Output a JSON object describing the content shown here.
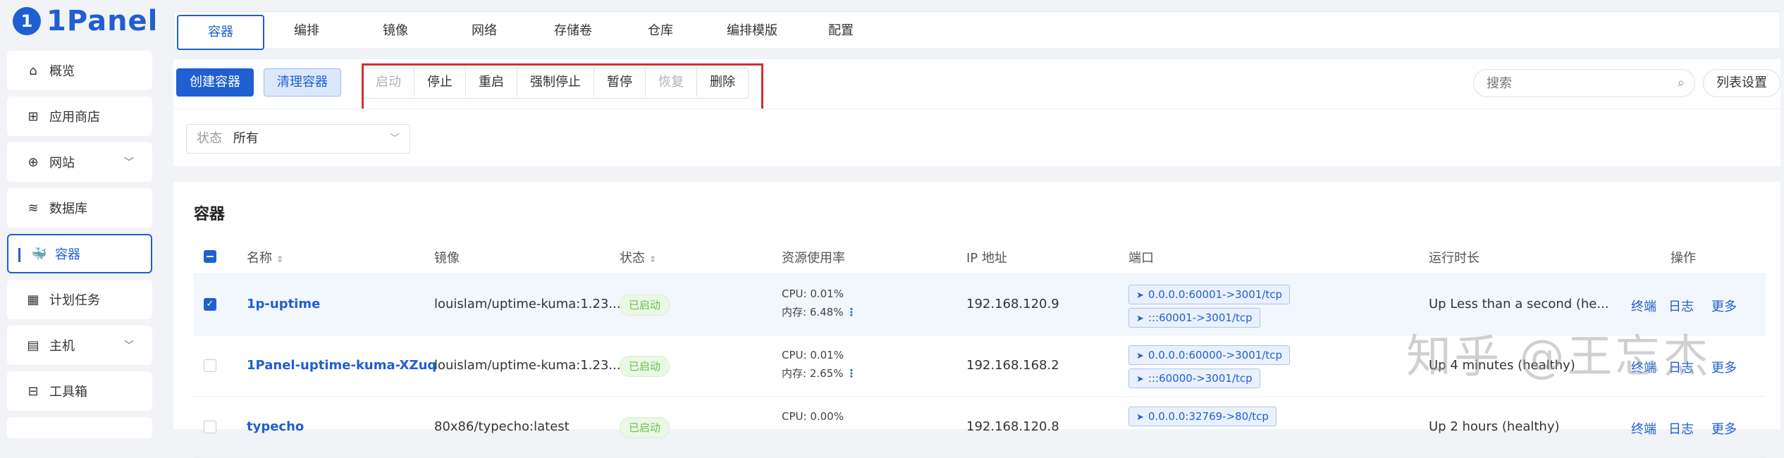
{
  "app": {
    "logo_text": "1Panel",
    "logo_mark": "1"
  },
  "sidebar": {
    "items": [
      {
        "label": "概览",
        "icon": "home-icon"
      },
      {
        "label": "应用商店",
        "icon": "grid-icon"
      },
      {
        "label": "网站",
        "icon": "globe-icon",
        "expandable": true
      },
      {
        "label": "数据库",
        "icon": "layers-icon"
      },
      {
        "label": "容器",
        "icon": "docker-icon",
        "active": true
      },
      {
        "label": "计划任务",
        "icon": "calendar-icon"
      },
      {
        "label": "主机",
        "icon": "server-icon",
        "expandable": true
      },
      {
        "label": "工具箱",
        "icon": "toolbox-icon"
      }
    ]
  },
  "tabs": [
    "容器",
    "编排",
    "镜像",
    "网络",
    "存储卷",
    "仓库",
    "编排模版",
    "配置"
  ],
  "actions": {
    "create": "创建容器",
    "clean": "清理容器",
    "group": [
      {
        "label": "启动",
        "disabled": true
      },
      {
        "label": "停止",
        "disabled": false
      },
      {
        "label": "重启",
        "disabled": false
      },
      {
        "label": "强制停止",
        "disabled": false
      },
      {
        "label": "暂停",
        "disabled": false
      },
      {
        "label": "恢复",
        "disabled": true
      },
      {
        "label": "删除",
        "disabled": false
      }
    ],
    "search_placeholder": "搜索",
    "list_settings": "列表设置"
  },
  "filter": {
    "label": "状态",
    "value": "所有"
  },
  "table": {
    "title": "容器",
    "headers": {
      "name": "名称",
      "image": "镜像",
      "state": "状态",
      "resource": "资源使用率",
      "ip": "IP 地址",
      "ports": "端口",
      "uptime": "运行时长",
      "ops": "操作"
    },
    "ops": {
      "terminal": "终端",
      "log": "日志",
      "more": "更多"
    },
    "rows": [
      {
        "name": "1p-uptime",
        "image": "louislam/uptime-kuma:1.23...",
        "state": "已启动",
        "cpu": "CPU: 0.01%",
        "mem": "内存: 6.48%",
        "ip": "192.168.120.9",
        "ports": [
          "0.0.0.0:60001->3001/tcp",
          ":::60001->3001/tcp"
        ],
        "uptime": "Up Less than a second (he...",
        "checked": true
      },
      {
        "name": "1Panel-uptime-kuma-XZuq",
        "image": "louislam/uptime-kuma:1.23...",
        "state": "已启动",
        "cpu": "CPU: 0.01%",
        "mem": "内存: 2.65%",
        "ip": "192.168.168.2",
        "ports": [
          "0.0.0.0:60000->3001/tcp",
          ":::60000->3001/tcp"
        ],
        "uptime": "Up 4 minutes (healthy)",
        "checked": false
      },
      {
        "name": "typecho",
        "image": "80x86/typecho:latest",
        "state": "已启动",
        "cpu": "CPU: 0.00%",
        "mem": "",
        "ip": "192.168.120.8",
        "ports": [
          "0.0.0.0:32769->80/tcp"
        ],
        "uptime": "Up 2 hours (healthy)",
        "checked": false
      }
    ]
  },
  "watermark": "知乎 @王忘杰",
  "colors": {
    "primary": "#1f5fd1",
    "highlight": "#d32f2f",
    "success": "#6cbf4b"
  }
}
